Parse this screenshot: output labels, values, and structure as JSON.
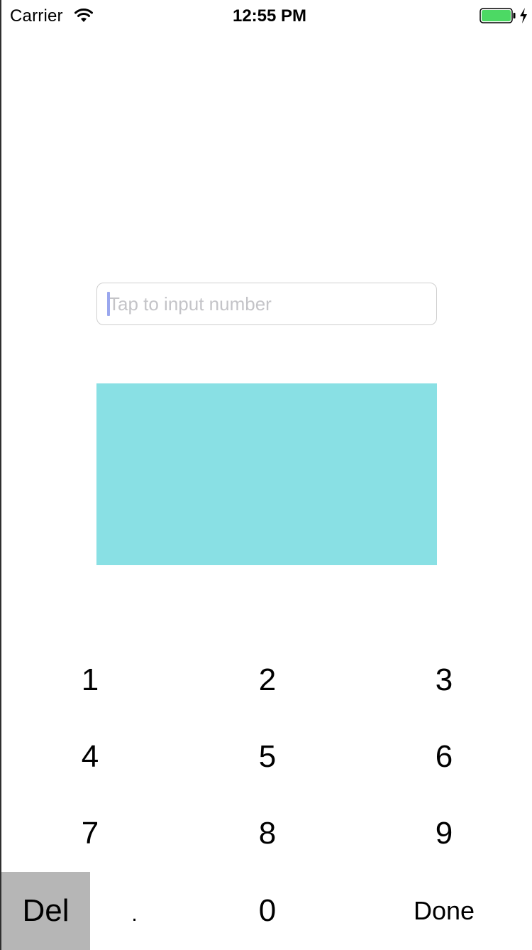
{
  "status_bar": {
    "carrier": "Carrier",
    "time": "12:55 PM",
    "battery_color": "#4cd964"
  },
  "number_field": {
    "placeholder": "Tap to input number",
    "value": ""
  },
  "color_box": {
    "color": "#89e0e4"
  },
  "keypad": {
    "keys": [
      "1",
      "2",
      "3",
      "4",
      "5",
      "6",
      "7",
      "8",
      "9"
    ],
    "del_label": "Del",
    "dot_label": ".",
    "zero_label": "0",
    "done_label": "Done"
  }
}
